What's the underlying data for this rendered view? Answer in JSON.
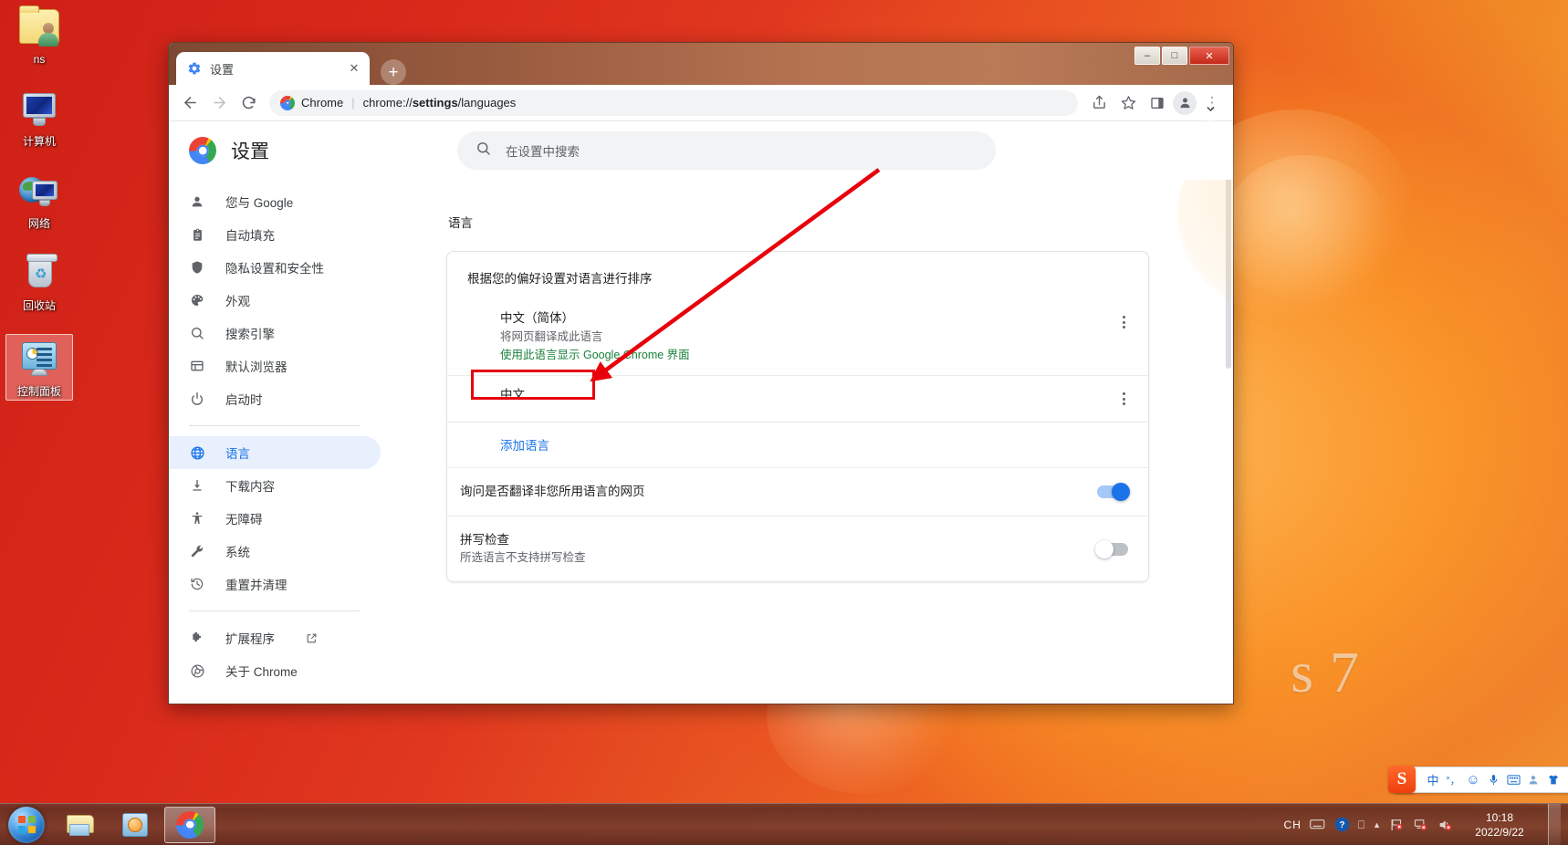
{
  "desktop": {
    "brand_watermark": "s 7",
    "icons": [
      {
        "label": "ns",
        "icon": "user-folder-icon",
        "selected": false
      },
      {
        "label": "计算机",
        "icon": "computer-icon",
        "selected": false
      },
      {
        "label": "网络",
        "icon": "network-icon",
        "selected": false
      },
      {
        "label": "回收站",
        "icon": "recycle-bin-icon",
        "selected": false
      },
      {
        "label": "控制面板",
        "icon": "control-panel-icon",
        "selected": true
      }
    ]
  },
  "window": {
    "minimize_label": "–",
    "maximize_label": "□",
    "close_label": "✕",
    "tab": {
      "title": "设置",
      "favicon": "gear-icon",
      "close_label": "✕"
    },
    "new_tab_label": "+"
  },
  "toolbar": {
    "back_label": "←",
    "forward_label": "→",
    "reload_label": "⟳",
    "omnibox": {
      "badge_text": "Chrome",
      "separator": "|",
      "url_prefix": "chrome://",
      "url_bold": "settings",
      "url_suffix": "/languages",
      "full_url": "chrome://settings/languages"
    },
    "share_label": "share-icon",
    "bookmark_label": "star-icon",
    "side_panel_label": "side-panel-icon",
    "profile_label": "profile-avatar",
    "menu_label": "⋮",
    "tab_search_label": "⌄"
  },
  "settings": {
    "title": "设置",
    "search": {
      "placeholder": "在设置中搜索",
      "icon": "search-icon"
    },
    "nav": [
      {
        "label": "您与 Google",
        "icon": "person-icon",
        "active": false
      },
      {
        "label": "自动填充",
        "icon": "clipboard-icon",
        "active": false
      },
      {
        "label": "隐私设置和安全性",
        "icon": "shield-icon",
        "active": false
      },
      {
        "label": "外观",
        "icon": "palette-icon",
        "active": false
      },
      {
        "label": "搜索引擎",
        "icon": "search-icon",
        "active": false
      },
      {
        "label": "默认浏览器",
        "icon": "browser-icon",
        "active": false
      },
      {
        "label": "启动时",
        "icon": "power-icon",
        "active": false
      },
      {
        "label": "语言",
        "icon": "globe-icon",
        "active": true
      },
      {
        "label": "下载内容",
        "icon": "download-icon",
        "active": false
      },
      {
        "label": "无障碍",
        "icon": "accessibility-icon",
        "active": false
      },
      {
        "label": "系统",
        "icon": "wrench-icon",
        "active": false
      },
      {
        "label": "重置并清理",
        "icon": "history-icon",
        "active": false
      }
    ],
    "nav_footer": [
      {
        "label": "扩展程序",
        "icon": "puzzle-icon",
        "external": true,
        "external_icon": "open-in-new-icon"
      },
      {
        "label": "关于 Chrome",
        "icon": "chrome-icon",
        "external": false
      }
    ]
  },
  "main": {
    "section_title": "语言",
    "card_heading": "根据您的偏好设置对语言进行排序",
    "languages": [
      {
        "name": "中文（简体）",
        "sub1": "将网页翻译成此语言",
        "sub2": "使用此语言显示 Google Chrome 界面",
        "menu_label": "kebab-menu"
      },
      {
        "name": "中文",
        "sub1": "",
        "sub2": "",
        "menu_label": "kebab-menu"
      }
    ],
    "add_language_label": "添加语言",
    "toggles": [
      {
        "title": "询问是否翻译非您所用语言的网页",
        "sub": "",
        "state": "on"
      },
      {
        "title": "拼写检查",
        "sub": "所选语言不支持拼写检查",
        "state": "off"
      }
    ]
  },
  "annotation": {
    "highlight_color": "#e8000b",
    "target": "添加语言"
  },
  "ime": {
    "logo": "S",
    "items": [
      {
        "icon": "chinese-mode-icon",
        "label": "中"
      },
      {
        "icon": "punctuation-icon",
        "label": "°，"
      },
      {
        "icon": "emoji-icon",
        "label": "☺"
      },
      {
        "icon": "microphone-icon",
        "label": "🎤"
      },
      {
        "icon": "keyboard-icon",
        "label": "⌨"
      },
      {
        "icon": "user-icon",
        "label": "👤"
      },
      {
        "icon": "skin-icon",
        "label": "👕"
      },
      {
        "icon": "toolbox-icon",
        "label": "▦"
      }
    ]
  },
  "taskbar": {
    "start_label": "start-orb",
    "items": [
      {
        "label": "explorer",
        "icon": "file-explorer-icon",
        "running": false
      },
      {
        "label": "media-player",
        "icon": "windows-media-player-icon",
        "running": false
      },
      {
        "label": "chrome",
        "icon": "chrome-icon",
        "running": true
      }
    ],
    "tray": {
      "language_indicator": "CH",
      "icons": [
        {
          "name": "keyboard-icon",
          "glyph": "⌨"
        },
        {
          "name": "help-icon",
          "glyph": "?"
        },
        {
          "name": "window-icon",
          "glyph": "❐"
        },
        {
          "name": "show-hidden-icon",
          "glyph": "▲"
        },
        {
          "name": "network-error-icon",
          "glyph": "⚑"
        },
        {
          "name": "action-center-icon",
          "glyph": "⚑"
        },
        {
          "name": "volume-muted-icon",
          "glyph": "🔊"
        }
      ],
      "time": "10:18",
      "date": "2022/9/22"
    }
  }
}
